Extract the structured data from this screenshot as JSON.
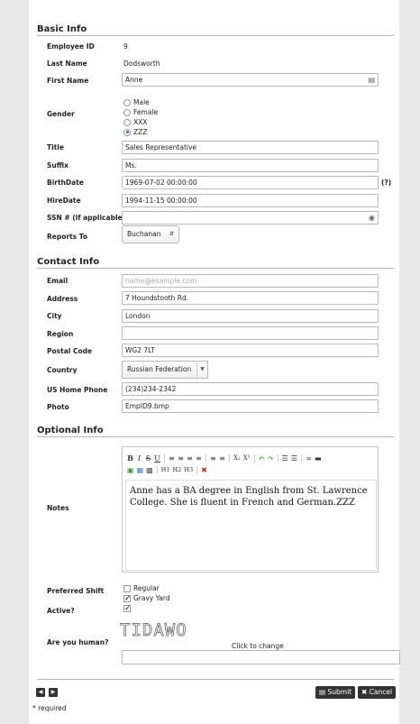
{
  "sections": {
    "basic": "Basic Info",
    "contact": "Contact Info",
    "optional": "Optional Info"
  },
  "basic": {
    "employee_id_label": "Employee ID",
    "employee_id": "9",
    "last_name_label": "Last Name",
    "last_name": "Dodsworth",
    "first_name_label": "First Name",
    "first_name": "Anne",
    "gender_label": "Gender",
    "gender_options": [
      "Male",
      "Female",
      "XXX",
      "ZZZ"
    ],
    "gender_selected": "ZZZ",
    "title_label": "Title",
    "title": "Sales Representative",
    "suffix_label": "Suffix",
    "suffix": "Ms.",
    "birthdate_label": "BirthDate",
    "birthdate": "1969-07-02 00:00:00",
    "birthdate_help": "(?)",
    "hiredate_label": "HireDate",
    "hiredate": "1994-11-15 00:00:00",
    "ssn_label": "SSN # (if applicable)",
    "ssn": "",
    "reports_to_label": "Reports To",
    "reports_to": "Buchanan"
  },
  "contact": {
    "email_label": "Email",
    "email_placeholder": "name@example.com",
    "address_label": "Address",
    "address": "7 Houndstooth Rd.",
    "city_label": "City",
    "city": "London",
    "region_label": "Region",
    "region": "",
    "postal_label": "Postal Code",
    "postal": "WG2 7LT",
    "country_label": "Country",
    "country": "Russian Federation",
    "phone_label": "US Home Phone",
    "phone": "(234)234-2342",
    "photo_label": "Photo",
    "photo": "EmpID9.bmp"
  },
  "optional": {
    "notes_label": "Notes",
    "notes": "Anne has a BA degree in English from St. Lawrence College. She is fluent in French and German.ZZZ",
    "toolbar": {
      "bold": "B",
      "italic": "I",
      "strike": "S",
      "underline": "U",
      "sub": "X₂",
      "sup": "X²",
      "h1": "H1",
      "h2": "H2",
      "h3": "H3",
      "remove": "✖"
    },
    "shift_label": "Preferred Shift",
    "shift_options": [
      {
        "label": "Regular",
        "checked": false
      },
      {
        "label": "Gravy Yard",
        "checked": true
      }
    ],
    "active_label": "Active?",
    "active": true,
    "human_label": "Are you human?",
    "captcha_text": "TIDAWO",
    "captcha_hint": "Click to change",
    "captcha_answer": ""
  },
  "footer": {
    "prev": "◀",
    "next": "▶",
    "submit": "Submit",
    "cancel": "Cancel",
    "required_note": "* required"
  }
}
